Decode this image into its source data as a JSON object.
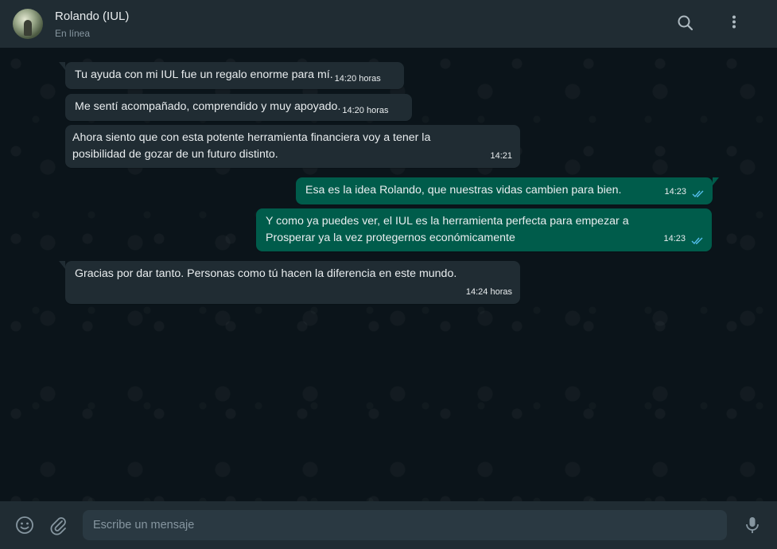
{
  "header": {
    "contact_name": "Rolando (IUL)",
    "status": "En línea",
    "icons": [
      "search-icon",
      "menu-icon"
    ]
  },
  "messages": [
    {
      "direction": "in",
      "text": "Tu ayuda con mi IUL fue un regalo enorme para mí.",
      "time": "14:20 horas"
    },
    {
      "direction": "in",
      "text": "Me sentí acompañado, comprendido y muy apoyado.",
      "time": "14:20 horas"
    },
    {
      "direction": "in",
      "text": "Ahora siento que con esta potente herramienta financiera voy a tener la posibilidad de gozar de un futuro distinto.",
      "time": "14:21"
    },
    {
      "direction": "out",
      "text": "Esa es la idea Rolando, que nuestras vidas cambien para bien.",
      "time": "14:23",
      "status": "read"
    },
    {
      "direction": "out",
      "text": "Y como ya puedes ver, el IUL es la herramienta perfecta para empezar a Prosperar ya la vez protegernos económicamente",
      "time": "14:23",
      "status": "read"
    },
    {
      "direction": "in",
      "text": "Gracias por dar tanto. Personas como tú hacen la diferencia en este mundo.",
      "time": "14:24 horas"
    }
  ],
  "composer": {
    "placeholder": "Escribe un mensaje"
  },
  "colors": {
    "header_bg": "#202c33",
    "chat_bg": "#0b141a",
    "incoming_bubble": "#202c33",
    "outgoing_bubble": "#005c4b",
    "read_ticks": "#53bdeb"
  }
}
